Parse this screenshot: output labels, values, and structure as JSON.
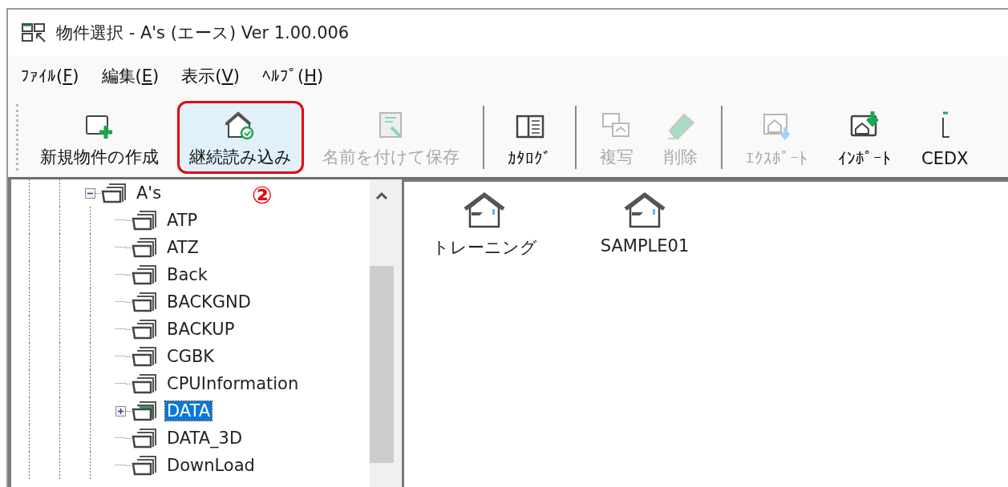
{
  "window": {
    "title": "物件選択 - A's (エース) Ver 1.00.006"
  },
  "menu": [
    {
      "label": "ﾌｧｲﾙ(F)"
    },
    {
      "label": "編集(E)"
    },
    {
      "label": "表示(V)"
    },
    {
      "label": "ﾍﾙﾌﾟ(H)"
    }
  ],
  "toolbar": [
    {
      "kind": "new",
      "label": "新規物件の作成",
      "disabled": false,
      "hovered": false,
      "annotated": false
    },
    {
      "kind": "reload",
      "label": "継続読み込み",
      "disabled": false,
      "hovered": true,
      "annotated": true
    },
    {
      "kind": "save",
      "label": "名前を付けて保存",
      "disabled": true,
      "hovered": false,
      "annotated": false
    },
    {
      "kind": "separator"
    },
    {
      "kind": "catalog",
      "label": "ｶﾀﾛｸﾞ",
      "disabled": false,
      "hovered": false,
      "annotated": false
    },
    {
      "kind": "separator"
    },
    {
      "kind": "copy",
      "label": "複写",
      "disabled": true,
      "hovered": false,
      "annotated": false
    },
    {
      "kind": "delete",
      "label": "削除",
      "disabled": true,
      "hovered": false,
      "annotated": false
    },
    {
      "kind": "separator"
    },
    {
      "kind": "export",
      "label": "ｴｸｽﾎﾟｰﾄ",
      "disabled": true,
      "hovered": false,
      "annotated": false
    },
    {
      "kind": "import",
      "label": "ｲﾝﾎﾟｰﾄ",
      "disabled": false,
      "hovered": false,
      "annotated": false
    },
    {
      "kind": "cedx",
      "label": "CEDX",
      "disabled": false,
      "hovered": false,
      "annotated": false
    }
  ],
  "annotation": {
    "text": "②"
  },
  "tree": [
    {
      "label": "A's",
      "expanded": true,
      "selected": false,
      "children": [
        {
          "label": "ATP",
          "selected": false
        },
        {
          "label": "ATZ",
          "selected": false
        },
        {
          "label": "Back",
          "selected": false
        },
        {
          "label": "BACKGND",
          "selected": false
        },
        {
          "label": "BACKUP",
          "selected": false
        },
        {
          "label": "CGBK",
          "selected": false
        },
        {
          "label": "CPUInformation",
          "selected": false
        },
        {
          "label": "DATA",
          "selected": true,
          "expanded": false,
          "has_children": true
        },
        {
          "label": "DATA_3D",
          "selected": false
        },
        {
          "label": "DownLoad",
          "selected": false
        }
      ]
    }
  ],
  "files": [
    {
      "label": "トレーニング",
      "selected": false
    },
    {
      "label": "SAMPLE01",
      "selected": false
    }
  ]
}
